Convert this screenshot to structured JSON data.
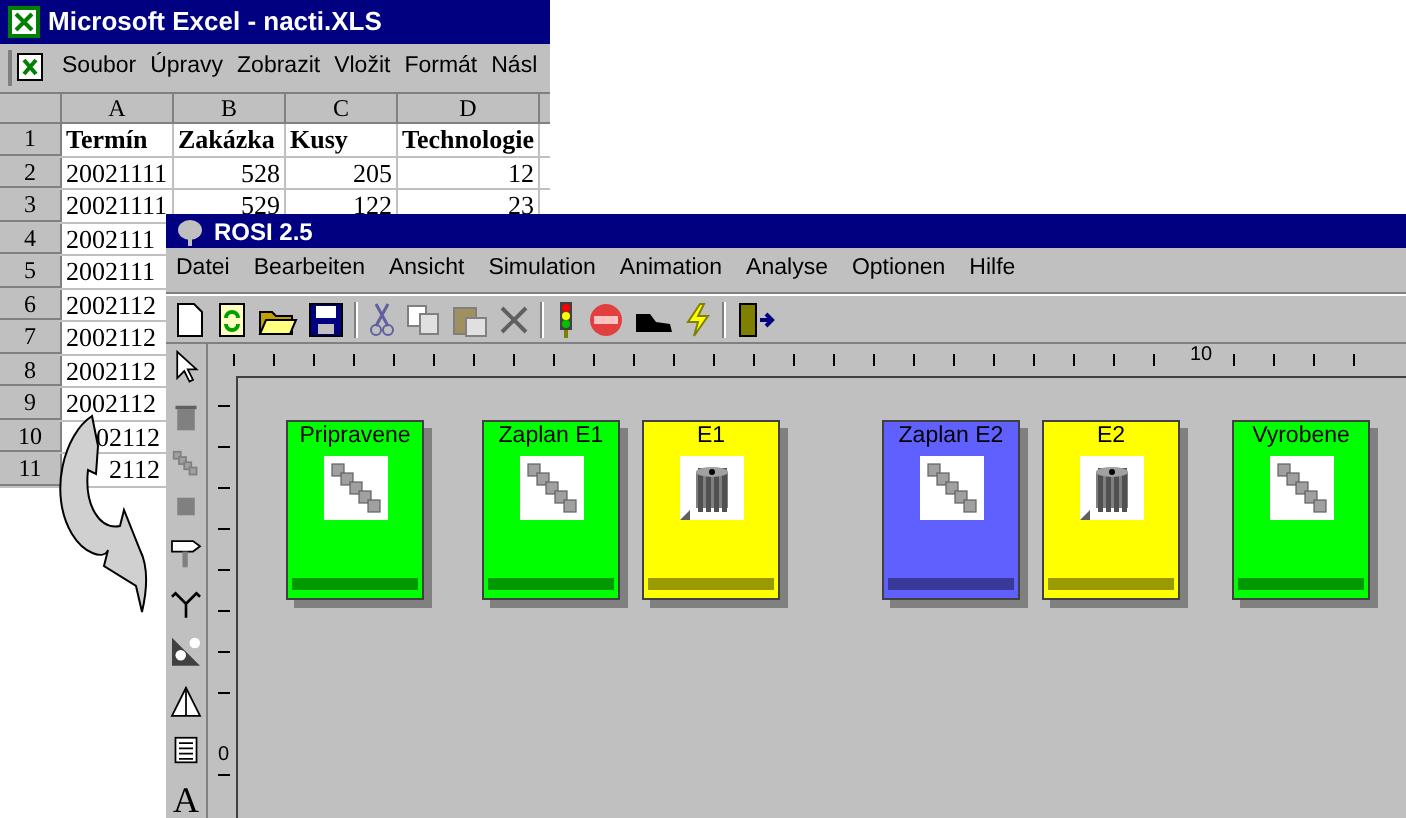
{
  "excel": {
    "title": "Microsoft Excel - nacti.XLS",
    "menu": [
      "Soubor",
      "Úpravy",
      "Zobrazit",
      "Vložit",
      "Formát",
      "Násl"
    ],
    "columns": [
      "A",
      "B",
      "C",
      "D"
    ],
    "rows": [
      {
        "number": "1",
        "cells": [
          "Termín",
          "Zakázka",
          "Kusy",
          "Technologie"
        ],
        "kind": "header"
      },
      {
        "number": "2",
        "cells": [
          "20021111",
          "528",
          "205",
          "12"
        ],
        "kind": "data"
      },
      {
        "number": "3",
        "cells": [
          "20021111",
          "529",
          "122",
          "23"
        ],
        "kind": "data"
      },
      {
        "number": "4",
        "cells": [
          "2002111"
        ],
        "kind": "data"
      },
      {
        "number": "5",
        "cells": [
          "2002111"
        ],
        "kind": "data"
      },
      {
        "number": "6",
        "cells": [
          "2002112"
        ],
        "kind": "data"
      },
      {
        "number": "7",
        "cells": [
          "2002112"
        ],
        "kind": "data"
      },
      {
        "number": "8",
        "cells": [
          "2002112"
        ],
        "kind": "data"
      },
      {
        "number": "9",
        "cells": [
          "2002112"
        ],
        "kind": "data"
      },
      {
        "number": "10",
        "cells": [
          "02112"
        ],
        "kind": "partial"
      },
      {
        "number": "11",
        "cells": [
          "2112"
        ],
        "kind": "partial"
      }
    ]
  },
  "rosi": {
    "title": "ROSI 2.5",
    "menu": [
      "Datei",
      "Bearbeiten",
      "Ansicht",
      "Simulation",
      "Animation",
      "Analyse",
      "Optionen",
      "Hilfe"
    ],
    "text_tool": "A",
    "ruler": {
      "top_label": "10",
      "left_label": "0"
    },
    "nodes": [
      {
        "label": "Pripravene",
        "kind": "queue",
        "color": "#00ff00"
      },
      {
        "label": "Zaplan E1",
        "kind": "queue",
        "color": "#00ff00"
      },
      {
        "label": "E1",
        "kind": "machine",
        "color": "#ffff00"
      },
      {
        "label": "Zaplan E2",
        "kind": "queue",
        "color": "#6060ff"
      },
      {
        "label": "E2",
        "kind": "machine",
        "color": "#ffff00"
      },
      {
        "label": "Vyrobene",
        "kind": "queue",
        "color": "#00ff00"
      }
    ]
  }
}
